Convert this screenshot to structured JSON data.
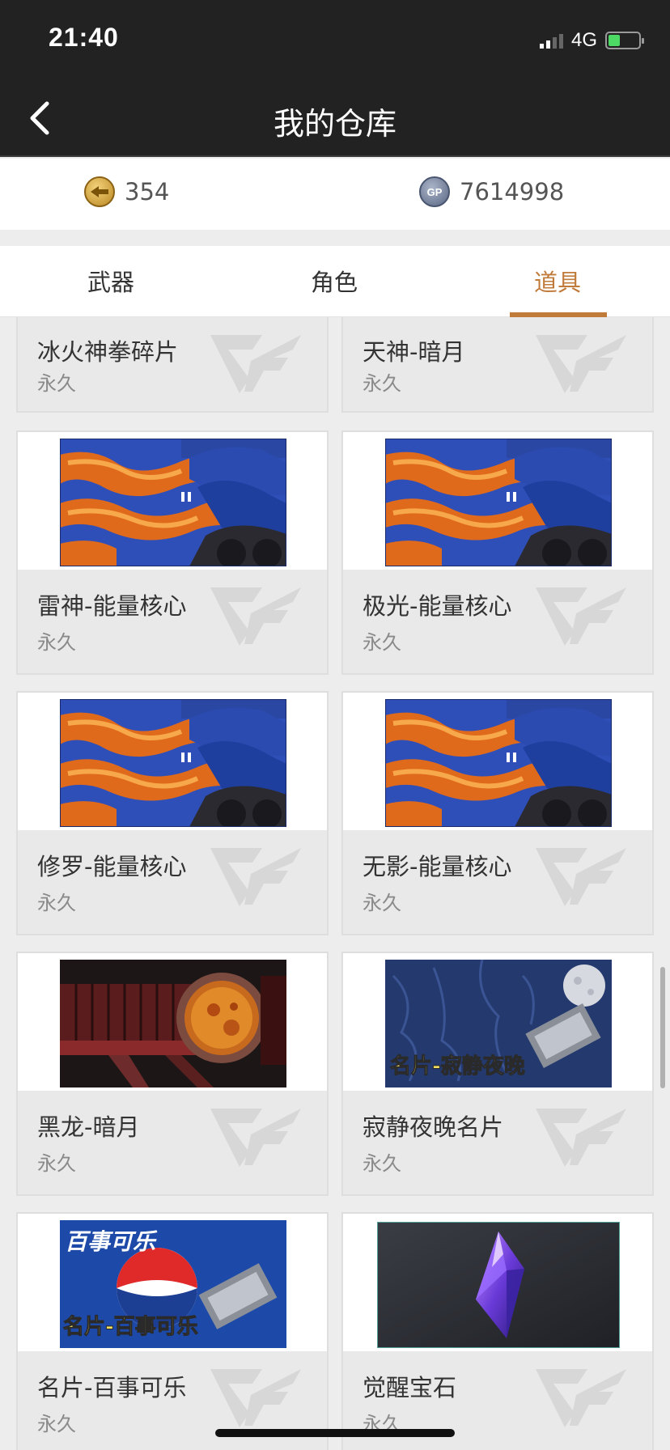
{
  "status_bar": {
    "time": "21:40",
    "network": "4G"
  },
  "header": {
    "title": "我的仓库"
  },
  "currency": {
    "cf_icon": "cf-coin-icon",
    "cf_value": "354",
    "gp_icon": "gp-coin-icon",
    "gp_label": "GP",
    "gp_value": "7614998"
  },
  "tabs": [
    {
      "label": "武器",
      "active": false
    },
    {
      "label": "角色",
      "active": false
    },
    {
      "label": "道具",
      "active": true
    }
  ],
  "accent_color": "#c07b3a",
  "items": [
    {
      "name": "冰火神拳碎片",
      "duration": "永久",
      "image": "none"
    },
    {
      "name": "天神-暗月",
      "duration": "永久",
      "image": "none"
    },
    {
      "name": "雷神-能量核心",
      "duration": "永久",
      "image": "flame-crate"
    },
    {
      "name": "极光-能量核心",
      "duration": "永久",
      "image": "flame-crate"
    },
    {
      "name": "修罗-能量核心",
      "duration": "永久",
      "image": "flame-crate"
    },
    {
      "name": "无影-能量核心",
      "duration": "永久",
      "image": "flame-crate"
    },
    {
      "name": "黑龙-暗月",
      "duration": "永久",
      "image": "dark-dragon-weapon"
    },
    {
      "name": "寂静夜晚名片",
      "duration": "永久",
      "image": "night-card",
      "image_text": "名片-寂静夜晚"
    },
    {
      "name": "名片-百事可乐",
      "duration": "永久",
      "image": "pepsi-card",
      "image_text": "名片-百事可乐",
      "image_brand": "百事可乐"
    },
    {
      "name": "觉醒宝石",
      "duration": "永久",
      "image": "purple-gem"
    }
  ]
}
